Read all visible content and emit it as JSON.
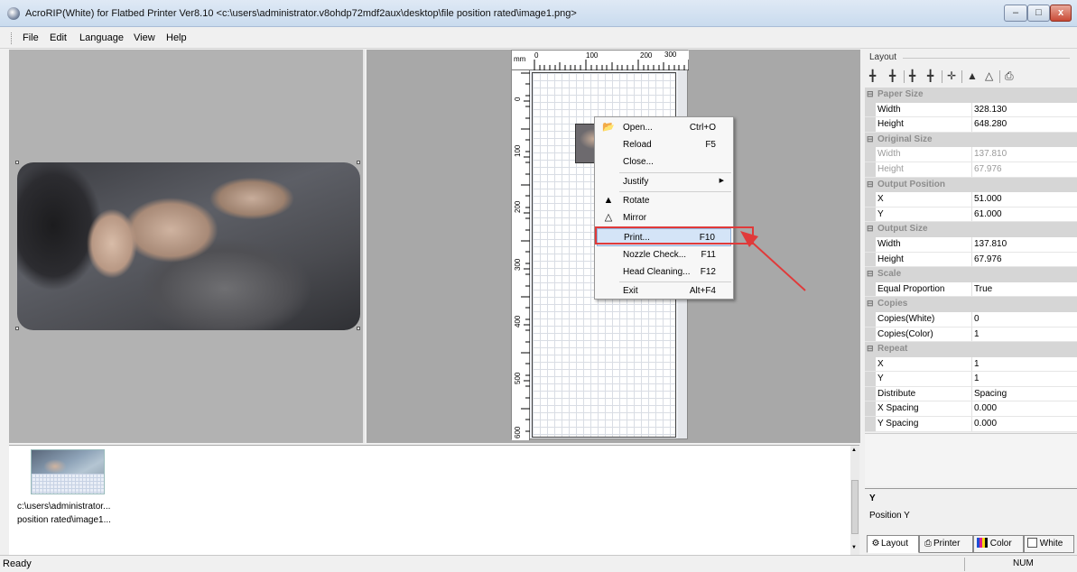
{
  "window": {
    "title": "AcroRIP(White) for Flatbed Printer Ver8.10 <c:\\users\\administrator.v8ohdp72mdf2aux\\desktop\\file position rated\\image1.png>",
    "close_glyph": "x"
  },
  "menubar": {
    "items": [
      "File",
      "Edit",
      "Language",
      "View",
      "Help"
    ]
  },
  "ruler": {
    "unit": "mm",
    "top_labels": [
      "0",
      "100",
      "200",
      "300"
    ],
    "left_labels": [
      "0",
      "100",
      "200",
      "300",
      "400",
      "500",
      "600"
    ]
  },
  "context_menu": {
    "items": [
      {
        "label": "Open...",
        "shortcut": "Ctrl+O",
        "icon": "folder-icon"
      },
      {
        "label": "Reload",
        "shortcut": "F5"
      },
      {
        "label": "Close...",
        "shortcut": ""
      },
      {
        "label": "Justify",
        "shortcut": "",
        "submenu": true
      },
      {
        "label": "Rotate",
        "shortcut": "",
        "icon": "rotate-icon"
      },
      {
        "label": "Mirror",
        "shortcut": "",
        "icon": "mirror-icon"
      },
      {
        "label": "Print...",
        "shortcut": "F10",
        "highlighted": true
      },
      {
        "label": "Nozzle Check...",
        "shortcut": "F11"
      },
      {
        "label": "Head Cleaning...",
        "shortcut": "F12"
      },
      {
        "label": "Exit",
        "shortcut": "Alt+F4"
      }
    ],
    "highlight_color": "#e03a3a"
  },
  "properties": {
    "panel_title": "Layout",
    "categories": [
      {
        "name": "Paper Size",
        "rows": [
          {
            "key": "Width",
            "value": "328.130"
          },
          {
            "key": "Height",
            "value": "648.280"
          }
        ]
      },
      {
        "name": "Original Size",
        "readonly": true,
        "rows": [
          {
            "key": "Width",
            "value": "137.810"
          },
          {
            "key": "Height",
            "value": "67.976"
          }
        ]
      },
      {
        "name": "Output Position",
        "rows": [
          {
            "key": "X",
            "value": "51.000"
          },
          {
            "key": "Y",
            "value": "61.000"
          }
        ]
      },
      {
        "name": "Output Size",
        "rows": [
          {
            "key": "Width",
            "value": "137.810"
          },
          {
            "key": "Height",
            "value": "67.976"
          }
        ]
      },
      {
        "name": "Scale",
        "rows": [
          {
            "key": "Equal Proportion",
            "value": "True"
          }
        ]
      },
      {
        "name": "Copies",
        "rows": [
          {
            "key": "Copies(White)",
            "value": "0"
          },
          {
            "key": "Copies(Color)",
            "value": "1"
          }
        ]
      },
      {
        "name": "Repeat",
        "rows": [
          {
            "key": "X",
            "value": "1"
          },
          {
            "key": "Y",
            "value": "1"
          },
          {
            "key": "Distribute",
            "value": "Spacing"
          },
          {
            "key": "X Spacing",
            "value": "0.000"
          },
          {
            "key": "Y Spacing",
            "value": "0.000"
          }
        ]
      }
    ],
    "description": {
      "title": "Y",
      "text": "Position Y"
    },
    "tabs": [
      "Layout",
      "Printer",
      "Color",
      "White"
    ]
  },
  "file_list": {
    "items": [
      {
        "caption_line1": "c:\\users\\administrator...",
        "caption_line2": "position rated\\image1..."
      }
    ]
  },
  "statusbar": {
    "text": "Ready",
    "num": "NUM"
  }
}
